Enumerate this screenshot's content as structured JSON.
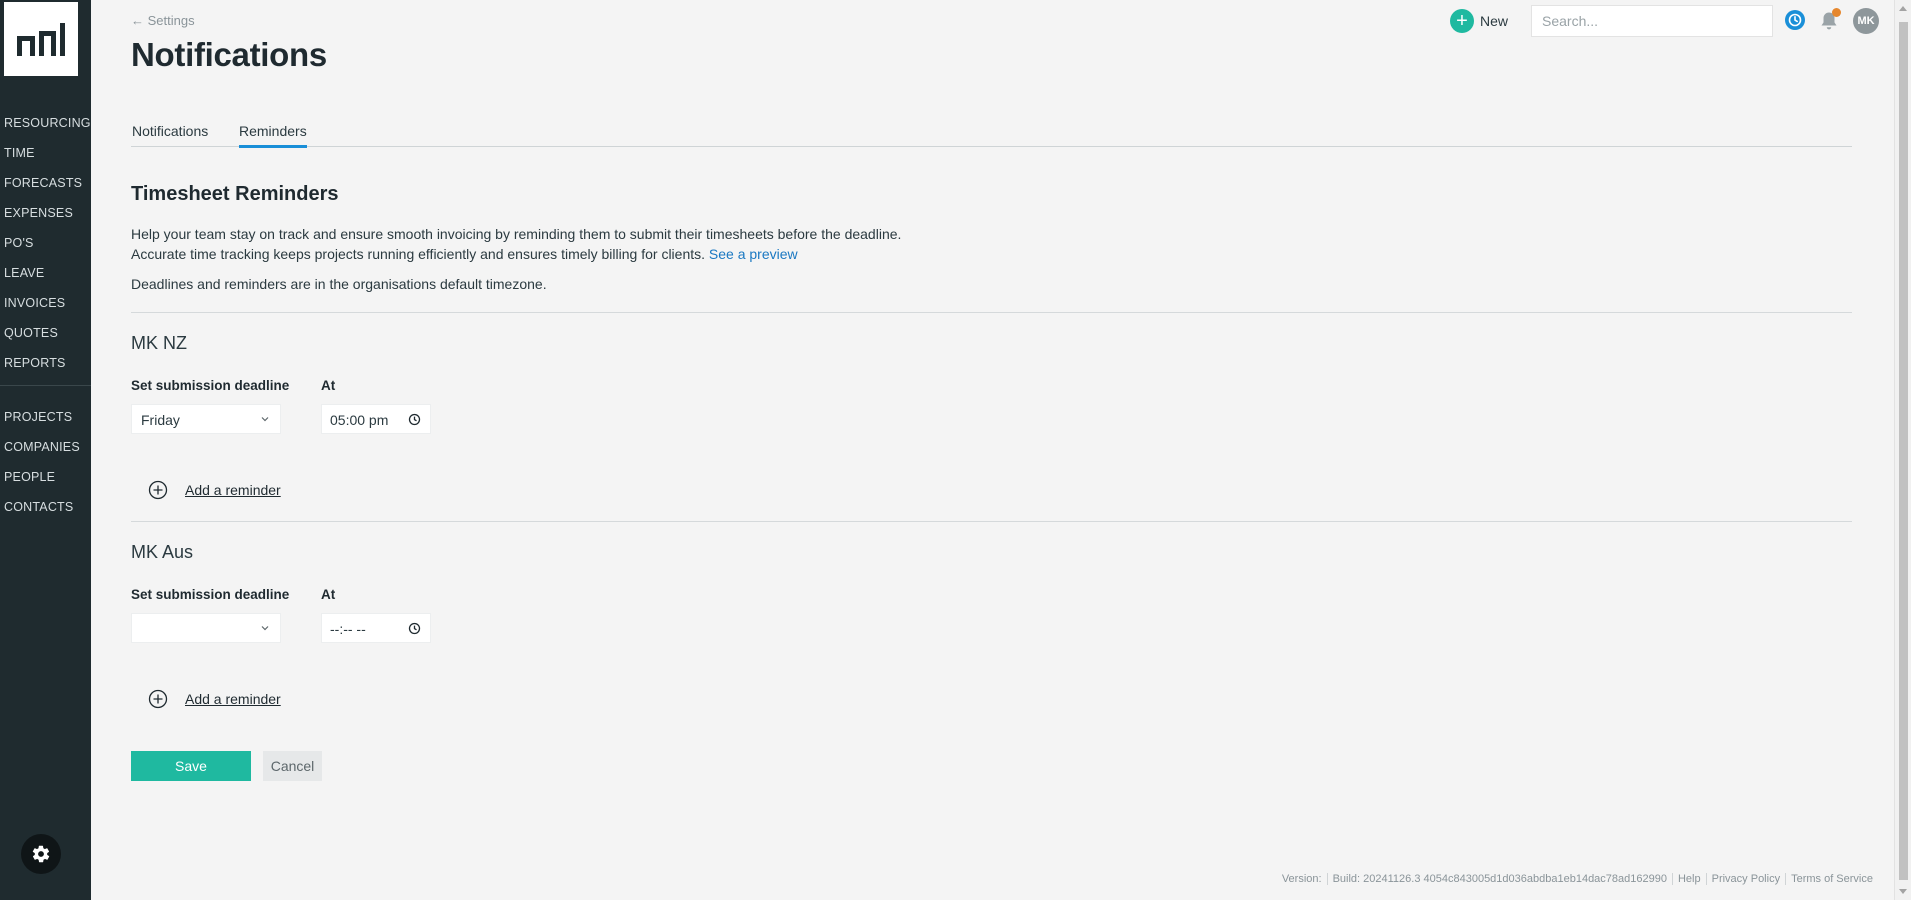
{
  "sidebar": {
    "logo": "pm-logo",
    "group1": [
      "RESOURCING",
      "TIME",
      "FORECASTS",
      "EXPENSES",
      "PO'S",
      "LEAVE",
      "INVOICES",
      "QUOTES",
      "REPORTS"
    ],
    "group2": [
      "PROJECTS",
      "COMPANIES",
      "PEOPLE",
      "CONTACTS"
    ],
    "settings_icon": "gear-icon"
  },
  "header": {
    "back_label": "← Settings",
    "title": "Notifications",
    "new_label": "New",
    "search_placeholder": "Search...",
    "avatar_initials": "MK"
  },
  "tabs": [
    {
      "label": "Notifications",
      "active": false
    },
    {
      "label": "Reminders",
      "active": true
    }
  ],
  "main": {
    "section_title": "Timesheet Reminders",
    "desc_line1": "Help your team stay on track and ensure smooth invoicing by reminding them to submit their timesheets before the deadline.",
    "desc_line2": "Accurate time tracking keeps projects running efficiently and ensures timely billing for clients.",
    "preview_link": "See a preview",
    "timezone_note": "Deadlines and reminders are in the organisations default timezone.",
    "deadline_label": "Set submission deadline",
    "at_label": "At",
    "add_reminder_label": "Add a reminder",
    "regions": [
      {
        "name": "MK NZ",
        "deadline_day": "Friday",
        "deadline_time": "05:00 pm"
      },
      {
        "name": "MK Aus",
        "deadline_day": "",
        "deadline_time": "--:-- --"
      }
    ],
    "save_label": "Save",
    "cancel_label": "Cancel"
  },
  "footer": {
    "version": "Version:",
    "build": "Build: 20241126.3 4054c843005d1d036abdba1eb14dac78ad162990",
    "help": "Help",
    "privacy": "Privacy Policy",
    "terms": "Terms of Service"
  },
  "colors": {
    "sidebar_bg": "#1f2b2f",
    "accent_teal": "#1fb9a0",
    "accent_blue": "#1a8fd8",
    "notification_dot": "#e6872d"
  }
}
